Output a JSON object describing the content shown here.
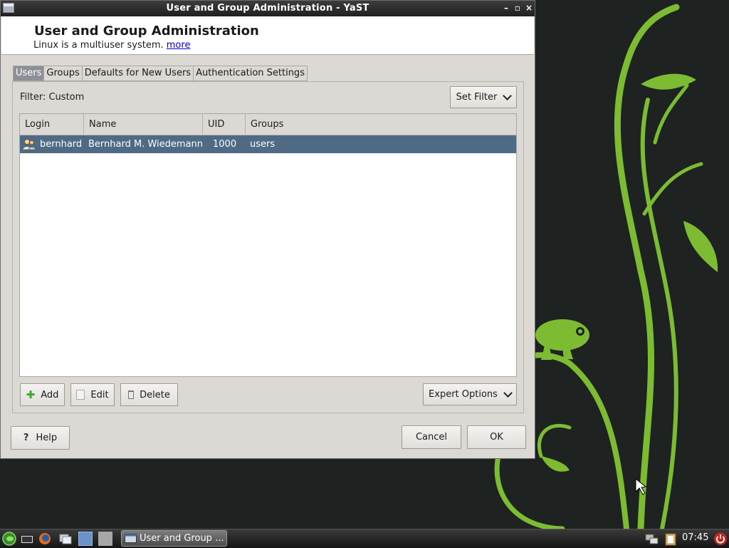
{
  "window": {
    "title": "User and Group Administration - YaST",
    "controls": [
      "–",
      "▫",
      "×"
    ]
  },
  "header": {
    "title": "User and Group Administration",
    "subtitle": "Linux is a multiuser system.",
    "more_link": "more"
  },
  "tabs": [
    {
      "label": "Users",
      "active": true
    },
    {
      "label": "Groups",
      "active": false
    },
    {
      "label": "Defaults for New Users",
      "active": false
    },
    {
      "label": "Authentication Settings",
      "active": false
    }
  ],
  "filter": {
    "label": "Filter: Custom",
    "set_filter_button": "Set Filter"
  },
  "table": {
    "columns": [
      "Login",
      "Name",
      "UID",
      "Groups"
    ],
    "rows": [
      {
        "login": "bernhard",
        "name": "Bernhard M. Wiedemann",
        "uid": "1000",
        "groups": "users",
        "selected": true
      }
    ]
  },
  "actions": {
    "add": "Add",
    "edit": "Edit",
    "delete": "Delete",
    "expert_options": "Expert Options"
  },
  "dialog_buttons": {
    "help": "Help",
    "cancel": "Cancel",
    "ok": "OK"
  },
  "taskbar": {
    "task_label": "User and Group ...",
    "clock": "07:45"
  },
  "colors": {
    "accent_green": "#7dbb32",
    "selection": "#4f6a85",
    "window_bg": "#dcd9d4"
  }
}
